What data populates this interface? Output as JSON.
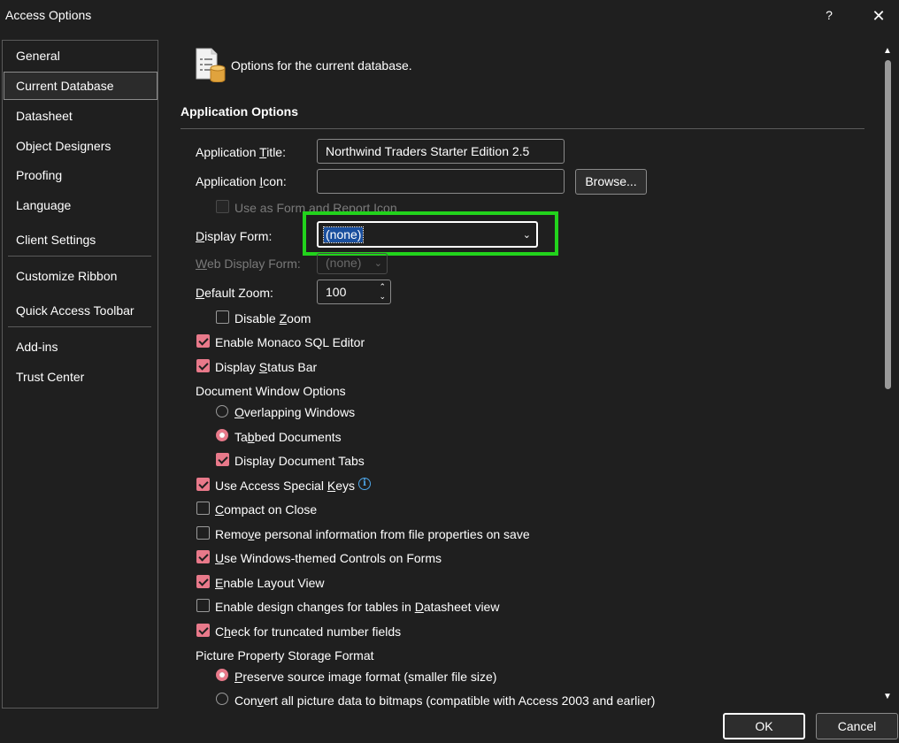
{
  "window": {
    "title": "Access Options",
    "help": "?",
    "close": "✕"
  },
  "nav": {
    "items": [
      {
        "label": "General"
      },
      {
        "label": "Current Database"
      },
      {
        "label": "Datasheet"
      },
      {
        "label": "Object Designers"
      },
      {
        "label": "Proofing"
      },
      {
        "label": "Language"
      },
      {
        "label": "Client Settings"
      },
      {
        "label": "Customize Ribbon"
      },
      {
        "label": "Quick Access Toolbar"
      },
      {
        "label": "Add-ins"
      },
      {
        "label": "Trust Center"
      }
    ],
    "selected": "Current Database"
  },
  "header": {
    "text": "Options for the current database."
  },
  "app_options": {
    "section_title": "Application Options",
    "app_title_label_pre": "Application ",
    "app_title_label_u": "T",
    "app_title_label_post": "itle:",
    "app_title_value": "Northwind Traders Starter Edition  2.5",
    "app_icon_label_pre": "Application ",
    "app_icon_label_u": "I",
    "app_icon_label_post": "con:",
    "app_icon_value": "",
    "browse_label": "Browse...",
    "use_as_form_icon_label": "Use as Form and Report Icon",
    "display_form_label_pre": "",
    "display_form_label_u": "D",
    "display_form_label_post": "isplay Form:",
    "display_form_value": "(none)",
    "web_display_form_label_pre": "",
    "web_display_form_label_u": "W",
    "web_display_form_label_post": "eb Display Form:",
    "web_display_form_value": "(none)",
    "default_zoom_label_pre": "",
    "default_zoom_label_u": "D",
    "default_zoom_label_post": "efault Zoom:",
    "default_zoom_value": "100",
    "disable_zoom_pre": "Disable ",
    "disable_zoom_u": "Z",
    "disable_zoom_post": "oom",
    "enable_monaco": "Enable Monaco SQL Editor",
    "display_status_pre": "Display ",
    "display_status_u": "S",
    "display_status_post": "tatus Bar",
    "doc_window_options": "Document Window Options",
    "overlapping_u": "O",
    "overlapping_post": "verlapping Windows",
    "tabbed_pre": "Ta",
    "tabbed_u": "b",
    "tabbed_post": "bed Documents",
    "display_doc_tabs": "Display Document Tabs",
    "use_special_keys_pre": "Use Access Special ",
    "use_special_keys_u": "K",
    "use_special_keys_post": "eys",
    "compact_u": "C",
    "compact_post": "ompact on Close",
    "remove_personal_pre": "Remo",
    "remove_personal_u": "v",
    "remove_personal_post": "e personal information from file properties on save",
    "use_windows_themed_u": "U",
    "use_windows_themed_post": "se Windows-themed Controls on Forms",
    "enable_layout_u": "E",
    "enable_layout_post": "nable Layout View",
    "enable_design_pre": "Enable design changes for tables in ",
    "enable_design_u": "D",
    "enable_design_post": "atasheet view",
    "check_truncated_pre": "C",
    "check_truncated_u": "h",
    "check_truncated_post": "eck for truncated number fields",
    "picture_storage": "Picture Property Storage Format",
    "preserve_u": "P",
    "preserve_post": "reserve source image format (smaller file size)",
    "convert_pre": "Con",
    "convert_u": "v",
    "convert_post": "ert all picture data to bitmaps (compatible with Access 2003 and earlier)"
  },
  "footer": {
    "ok": "OK",
    "cancel": "Cancel"
  },
  "colors": {
    "accent": "#e8798a",
    "highlight_box": "#22d31c",
    "selection": "#1a4f9e",
    "info": "#4ea6e8"
  }
}
